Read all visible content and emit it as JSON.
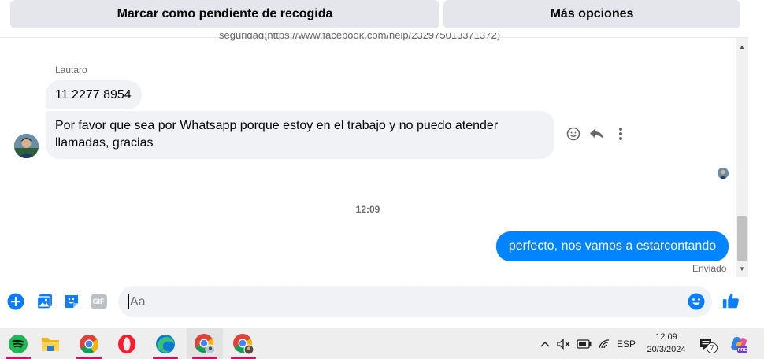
{
  "top_actions": {
    "mark_pending": "Marcar como pendiente de recogida",
    "more_options": "Más opciones"
  },
  "conversation": {
    "cut_text": "seguridad(https://www.facebook.com/help/232975013371372)",
    "sender_name": "Lautaro",
    "incoming": [
      "11 2277 8954",
      "Por favor que sea por Whatsapp porque estoy en el trabajo y no puedo atender llamadas, gracias"
    ],
    "time_separator": "12:09",
    "outgoing": "perfecto, nos vamos a estarcontando",
    "sent_status": "Enviado"
  },
  "composer": {
    "placeholder": "Aa",
    "gif_label": "GIF"
  },
  "taskbar": {
    "apps": [
      "Spotify",
      "File Explorer",
      "Google Chrome",
      "Opera",
      "Microsoft Edge",
      "Google Chrome profile",
      "Google Chrome profile 2"
    ],
    "language": "ESP",
    "time": "12:09",
    "date": "20/3/2024",
    "notification_count": "7",
    "copilot_badge": "PRE"
  },
  "colors": {
    "messenger_blue": "#0084ff",
    "bubble_gray": "#f0f2f5",
    "button_gray": "#e4e6eb",
    "icon_blue": "#0a7cff"
  }
}
